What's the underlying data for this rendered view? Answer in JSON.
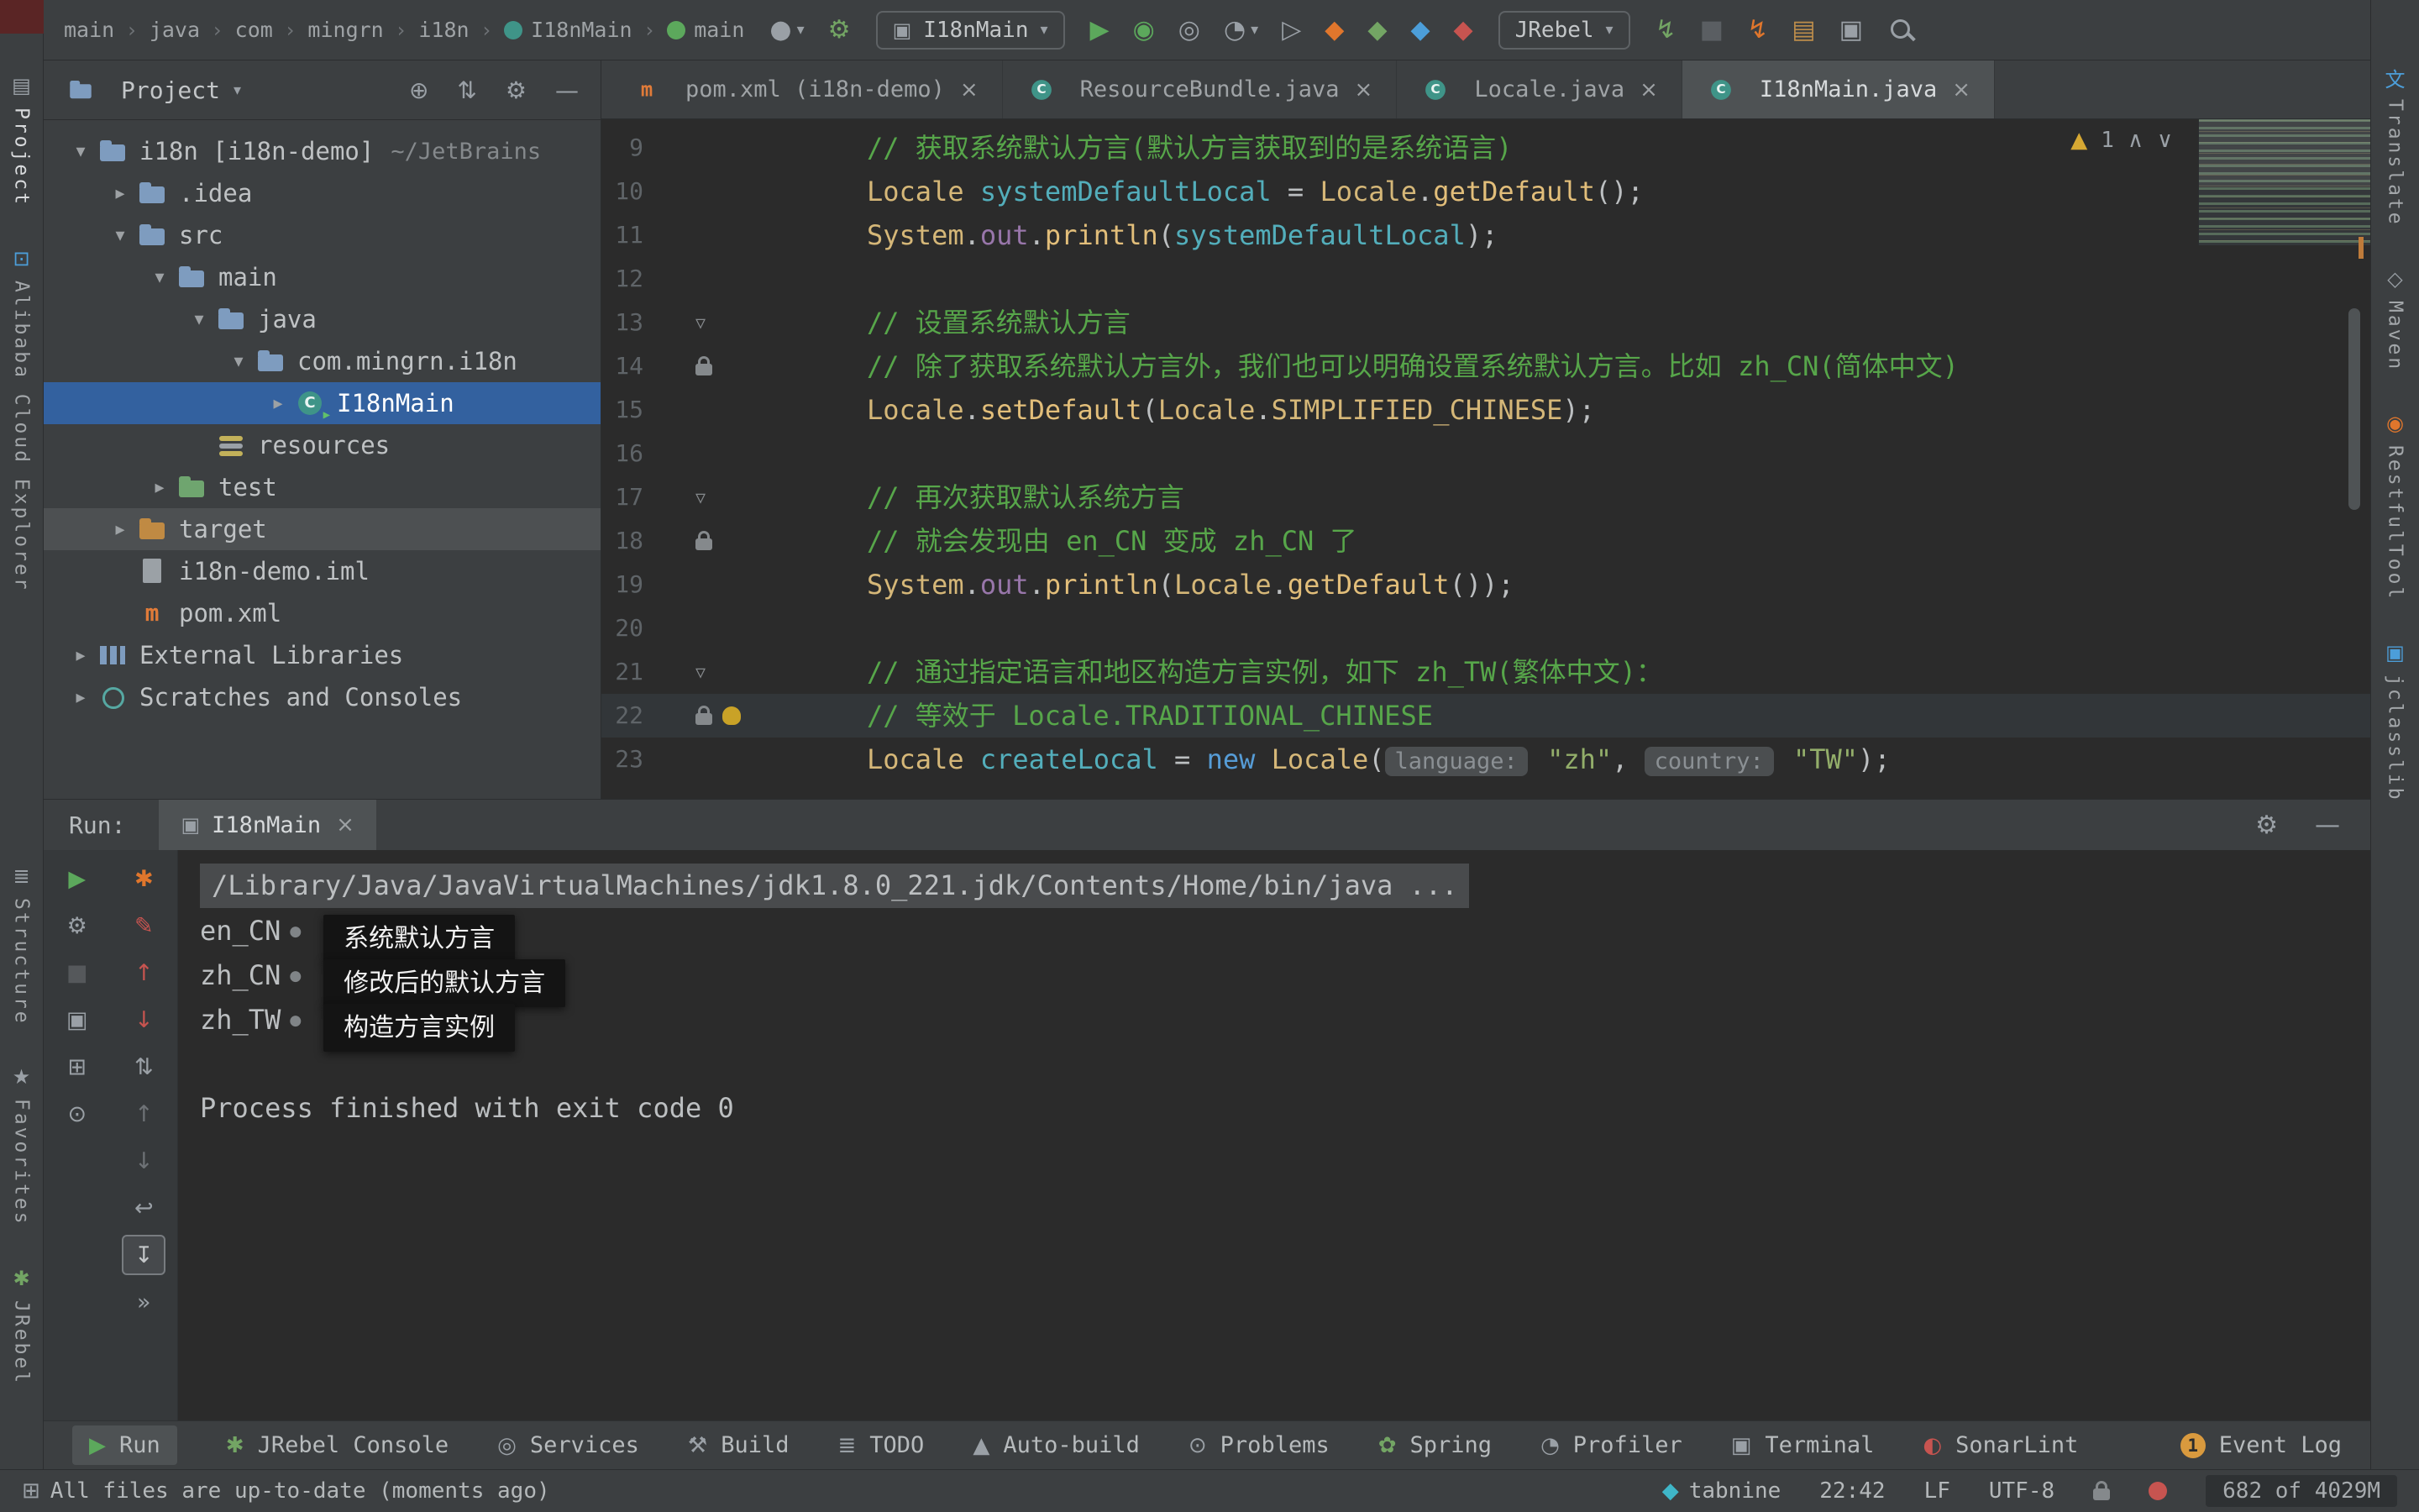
{
  "toolbar": {
    "breadcrumbs": [
      {
        "label": "main"
      },
      {
        "label": "java"
      },
      {
        "label": "com"
      },
      {
        "label": "mingrn"
      },
      {
        "label": "i18n"
      },
      {
        "label": "I18nMain",
        "icon": "class"
      },
      {
        "label": "main",
        "icon": "method"
      }
    ],
    "run_config_label": "I18nMain",
    "jrebel_label": "JRebel",
    "actions_a": [
      {
        "name": "user-menu-icon",
        "glyph": "●",
        "color": "#9aa0a6",
        "caret": true
      },
      {
        "name": "jrebel-setup-icon",
        "glyph": "⚙",
        "color": "#73a564"
      }
    ],
    "actions_b": [
      {
        "name": "run-icon",
        "glyph": "▶",
        "color": "#5ca85c"
      },
      {
        "name": "debug-icon",
        "glyph": "◉",
        "color": "#5ca85c"
      },
      {
        "name": "coverage-icon",
        "glyph": "◎",
        "color": "#9aa0a6"
      },
      {
        "name": "profiler-icon",
        "glyph": "◔",
        "color": "#9aa0a6",
        "caret": true
      },
      {
        "name": "run-anything-icon",
        "glyph": "▷",
        "color": "#9aa0a6"
      },
      {
        "name": "jrebel-run-icon",
        "glyph": "◆",
        "color": "#e0762c"
      },
      {
        "name": "jrebel-debug-icon",
        "glyph": "◆",
        "color": "#73a564"
      },
      {
        "name": "jrebel-remote-run-icon",
        "glyph": "◆",
        "color": "#4c9ed9"
      },
      {
        "name": "jrebel-remote-debug-icon",
        "glyph": "◆",
        "color": "#c75450"
      }
    ],
    "actions_c": [
      {
        "name": "rebel-agent-icon",
        "glyph": "↯",
        "color": "#73a564"
      },
      {
        "name": "stop-icon",
        "glyph": "■",
        "color": "#5a5e62"
      },
      {
        "name": "hotswap-icon",
        "glyph": "↯",
        "color": "#e0762c"
      },
      {
        "name": "open-project-icon",
        "glyph": "▤",
        "color": "#bd8d4b"
      },
      {
        "name": "restore-layout-icon",
        "glyph": "▣",
        "color": "#9aa0a6"
      },
      {
        "name": "search-everywhere-icon",
        "glyph": "",
        "css": "search"
      }
    ]
  },
  "tabs": [
    {
      "label": "pom.xml (i18n-demo)",
      "icon": "maven"
    },
    {
      "label": "ResourceBundle.java",
      "icon": "class"
    },
    {
      "label": "Locale.java",
      "icon": "class"
    },
    {
      "label": "I18nMain.java",
      "icon": "class",
      "active": true
    }
  ],
  "project": {
    "header": {
      "title": "Project",
      "icons": [
        {
          "name": "locate-file-icon",
          "glyph": "⊕"
        },
        {
          "name": "collapse-all-icon",
          "glyph": "⇅"
        },
        {
          "name": "settings-icon",
          "glyph": "⚙"
        },
        {
          "name": "hide-panel-icon",
          "glyph": "—"
        }
      ]
    },
    "tree": [
      {
        "label": "i18n [i18n-demo]",
        "suffix": "~/JetBrains",
        "indent": 0,
        "arrow": "open",
        "icon": "folder"
      },
      {
        "label": ".idea",
        "indent": 1,
        "arrow": "closed",
        "icon": "folder"
      },
      {
        "label": "src",
        "indent": 1,
        "arrow": "open",
        "icon": "folder"
      },
      {
        "label": "main",
        "indent": 2,
        "arrow": "open",
        "icon": "folder"
      },
      {
        "label": "java",
        "indent": 3,
        "arrow": "open",
        "icon": "folder"
      },
      {
        "label": "com.mingrn.i18n",
        "indent": 4,
        "arrow": "open",
        "icon": "folder"
      },
      {
        "label": "I18nMain",
        "indent": 5,
        "arrow": "closed",
        "icon": "class",
        "selected": true,
        "badge": "run"
      },
      {
        "label": "resources",
        "indent": 3,
        "arrow": "none",
        "icon": "resources"
      },
      {
        "label": "test",
        "indent": 2,
        "arrow": "closed",
        "icon": "folder-green"
      },
      {
        "label": "target",
        "indent": 1,
        "arrow": "closed",
        "icon": "folder-orange",
        "highlight": true
      },
      {
        "label": "i18n-demo.iml",
        "indent": 1,
        "arrow": "none",
        "icon": "file"
      },
      {
        "label": "pom.xml",
        "indent": 1,
        "arrow": "none",
        "icon": "maven"
      },
      {
        "label": "External Libraries",
        "indent": 0,
        "arrow": "closed",
        "icon": "lib"
      },
      {
        "label": "Scratches and Consoles",
        "indent": 0,
        "arrow": "closed",
        "icon": "scratch"
      }
    ]
  },
  "editor": {
    "inspection": {
      "warnings": "1"
    },
    "lines": [
      {
        "num": "9",
        "gutter": [],
        "tokens": [
          {
            "c": "cmt",
            "t": "// 获取系统默认方言(默认方言获取到的是系统语言)"
          }
        ]
      },
      {
        "num": "10",
        "gutter": [],
        "tokens": [
          {
            "c": "cls",
            "t": "Locale"
          },
          {
            "c": "pln",
            "t": " "
          },
          {
            "c": "var",
            "t": "systemDefaultLocal"
          },
          {
            "c": "pln",
            "t": " = "
          },
          {
            "c": "cls",
            "t": "Locale"
          },
          {
            "c": "pln",
            "t": "."
          },
          {
            "c": "mth",
            "t": "getDefault"
          },
          {
            "c": "pln",
            "t": "();"
          }
        ]
      },
      {
        "num": "11",
        "gutter": [],
        "tokens": [
          {
            "c": "cls",
            "t": "System"
          },
          {
            "c": "pln",
            "t": "."
          },
          {
            "c": "fld",
            "t": "out"
          },
          {
            "c": "pln",
            "t": "."
          },
          {
            "c": "mth",
            "t": "println"
          },
          {
            "c": "pln",
            "t": "("
          },
          {
            "c": "var",
            "t": "systemDefaultLocal"
          },
          {
            "c": "pln",
            "t": ");"
          }
        ]
      },
      {
        "num": "12",
        "gutter": [],
        "tokens": []
      },
      {
        "num": "13",
        "gutter": [
          "fold"
        ],
        "tokens": [
          {
            "c": "cmt",
            "t": "// 设置系统默认方言"
          }
        ]
      },
      {
        "num": "14",
        "gutter": [
          "lock"
        ],
        "tokens": [
          {
            "c": "cmt",
            "t": "// 除了获取系统默认方言外，我们也可以明确设置系统默认方言。比如 zh_CN(简体中文)"
          }
        ]
      },
      {
        "num": "15",
        "gutter": [],
        "tokens": [
          {
            "c": "cls",
            "t": "Locale"
          },
          {
            "c": "pln",
            "t": "."
          },
          {
            "c": "mth",
            "t": "setDefault"
          },
          {
            "c": "pln",
            "t": "("
          },
          {
            "c": "cls",
            "t": "Locale"
          },
          {
            "c": "pln",
            "t": "."
          },
          {
            "c": "const",
            "t": "SIMPLIFIED_CHINESE"
          },
          {
            "c": "pln",
            "t": ");"
          }
        ]
      },
      {
        "num": "16",
        "gutter": [],
        "tokens": []
      },
      {
        "num": "17",
        "gutter": [
          "fold"
        ],
        "tokens": [
          {
            "c": "cmt",
            "t": "// 再次获取默认系统方言"
          }
        ]
      },
      {
        "num": "18",
        "gutter": [
          "lock"
        ],
        "tokens": [
          {
            "c": "cmt",
            "t": "// 就会发现由 en_CN 变成 zh_CN 了"
          }
        ]
      },
      {
        "num": "19",
        "gutter": [],
        "tokens": [
          {
            "c": "cls",
            "t": "System"
          },
          {
            "c": "pln",
            "t": "."
          },
          {
            "c": "fld",
            "t": "out"
          },
          {
            "c": "pln",
            "t": "."
          },
          {
            "c": "mth",
            "t": "println"
          },
          {
            "c": "pln",
            "t": "("
          },
          {
            "c": "cls",
            "t": "Locale"
          },
          {
            "c": "pln",
            "t": "."
          },
          {
            "c": "mth",
            "t": "getDefault"
          },
          {
            "c": "pln",
            "t": "());"
          }
        ]
      },
      {
        "num": "20",
        "gutter": [],
        "tokens": []
      },
      {
        "num": "21",
        "gutter": [
          "fold"
        ],
        "tokens": [
          {
            "c": "cmt",
            "t": "// 通过指定语言和地区构造方言实例，如下 zh_TW(繁体中文)："
          }
        ]
      },
      {
        "num": "22",
        "gutter": [
          "lock",
          "bulb"
        ],
        "caret": true,
        "tokens": [
          {
            "c": "cmt",
            "t": "// 等效于 Locale.TRADITIONAL_CHINESE"
          }
        ]
      },
      {
        "num": "23",
        "gutter": [],
        "tokens": [
          {
            "c": "cls",
            "t": "Locale"
          },
          {
            "c": "pln",
            "t": " "
          },
          {
            "c": "var",
            "t": "createLocal"
          },
          {
            "c": "pln",
            "t": " = "
          },
          {
            "c": "kw",
            "t": "new"
          },
          {
            "c": "pln",
            "t": " "
          },
          {
            "c": "cls",
            "t": "Locale"
          },
          {
            "c": "pln",
            "t": "("
          },
          {
            "c": "hint",
            "t": "language:"
          },
          {
            "c": "pln",
            "t": " "
          },
          {
            "c": "str",
            "t": "\"zh\""
          },
          {
            "c": "pln",
            "t": ", "
          },
          {
            "c": "hint",
            "t": "country:"
          },
          {
            "c": "pln",
            "t": " "
          },
          {
            "c": "str",
            "t": "\"TW\""
          },
          {
            "c": "pln",
            "t": ");"
          }
        ]
      }
    ]
  },
  "run": {
    "label": "Run:",
    "tab": "I18nMain",
    "header_icons": [
      {
        "name": "run-settings-icon",
        "glyph": "⚙"
      },
      {
        "name": "hide-run-panel-icon",
        "glyph": "—"
      }
    ],
    "rail_col1": [
      {
        "name": "rerun-icon",
        "glyph": "▶",
        "color": "#5ca85c"
      },
      {
        "name": "run-settings-icon",
        "glyph": "⚙",
        "color": "#9aa0a6"
      },
      {
        "name": "stop-icon",
        "glyph": "■",
        "color": "#55585b"
      },
      {
        "name": "capture-icon",
        "glyph": "▣",
        "color": "#9aa0a6"
      },
      {
        "name": "layout-icon",
        "glyph": "⊞",
        "color": "#9aa0a6"
      },
      {
        "name": "pin-icon",
        "glyph": "⊙",
        "color": "#9aa0a6"
      }
    ],
    "rail_col2": [
      {
        "name": "jrebel-agent-icon",
        "glyph": "✱",
        "color": "#e0762c"
      },
      {
        "name": "mark-icon",
        "glyph": "✎",
        "color": "#c75450"
      },
      {
        "name": "up-stack-icon",
        "glyph": "↑",
        "color": "#c75450"
      },
      {
        "name": "down-stack-icon",
        "glyph": "↓",
        "color": "#c75450"
      },
      {
        "name": "sort-icon",
        "glyph": "⇅",
        "color": "#9aa0a6"
      },
      {
        "name": "prev-occurrence-icon",
        "glyph": "↑",
        "color": "#6e7276"
      },
      {
        "name": "next-occurrence-icon",
        "glyph": "↓",
        "color": "#6e7276"
      },
      {
        "name": "soft-wrap-icon",
        "glyph": "↩",
        "color": "#9aa0a6"
      },
      {
        "name": "scroll-to-end-icon",
        "glyph": "↧",
        "color": "#c3c6c8",
        "boxed": true
      },
      {
        "name": "more-icon",
        "glyph": "»",
        "color": "#9aa0a6"
      }
    ],
    "console": {
      "cmd": "/Library/Java/JavaVirtualMachines/jdk1.8.0_221.jdk/Contents/Home/bin/java ...",
      "entries": [
        {
          "value": "en_CN",
          "tip": "系统默认方言"
        },
        {
          "value": "zh_CN",
          "tip": "修改后的默认方言"
        },
        {
          "value": "zh_TW",
          "tip": "构造方言实例"
        }
      ],
      "exit": "Process finished with exit code 0"
    }
  },
  "bottom_bar": {
    "items": [
      {
        "label": "Run",
        "glyph": "▶",
        "color": "#5ca85c",
        "active": true
      },
      {
        "label": "JRebel Console",
        "glyph": "✱",
        "color": "#73a564"
      },
      {
        "label": "Services",
        "glyph": "◎",
        "color": "#9aa0a6"
      },
      {
        "label": "Build",
        "glyph": "⚒",
        "color": "#9aa0a6"
      },
      {
        "label": "TODO",
        "glyph": "≣",
        "color": "#9aa0a6"
      },
      {
        "label": "Auto-build",
        "glyph": "▲",
        "color": "#9aa0a6"
      },
      {
        "label": "Problems",
        "glyph": "⊙",
        "color": "#9aa0a6"
      },
      {
        "label": "Spring",
        "glyph": "✿",
        "color": "#73a564"
      },
      {
        "label": "Profiler",
        "glyph": "◔",
        "color": "#9aa0a6"
      },
      {
        "label": "Terminal",
        "glyph": "▣",
        "color": "#9aa0a6"
      },
      {
        "label": "SonarLint",
        "glyph": "◐",
        "color": "#c75450"
      }
    ],
    "right_items": [
      {
        "label": "Event Log",
        "badge": "1"
      }
    ]
  },
  "status_bar": {
    "left_text": "All files are up-to-date (moments ago)",
    "tabnine": "tabnine",
    "time": "22:42",
    "line_ending": "LF",
    "encoding": "UTF-8",
    "memory": "682 of 4029M"
  },
  "left_stripe": {
    "top": [
      {
        "label": "Project",
        "icon": "folder",
        "active": true
      },
      {
        "label": "Alibaba Cloud Explorer",
        "icon": "alibaba"
      }
    ],
    "bottom": [
      {
        "label": "Structure",
        "icon": "structure"
      },
      {
        "label": "Favorites",
        "icon": "star"
      },
      {
        "label": "JRebel",
        "icon": "jrebel"
      }
    ]
  },
  "right_stripe": [
    {
      "label": "Translate",
      "icon": "translate"
    },
    {
      "label": "Maven",
      "icon": "maven-s"
    },
    {
      "label": "RestfulTool",
      "icon": "restful"
    },
    {
      "label": "jclasslib",
      "icon": "jclasslib"
    }
  ]
}
